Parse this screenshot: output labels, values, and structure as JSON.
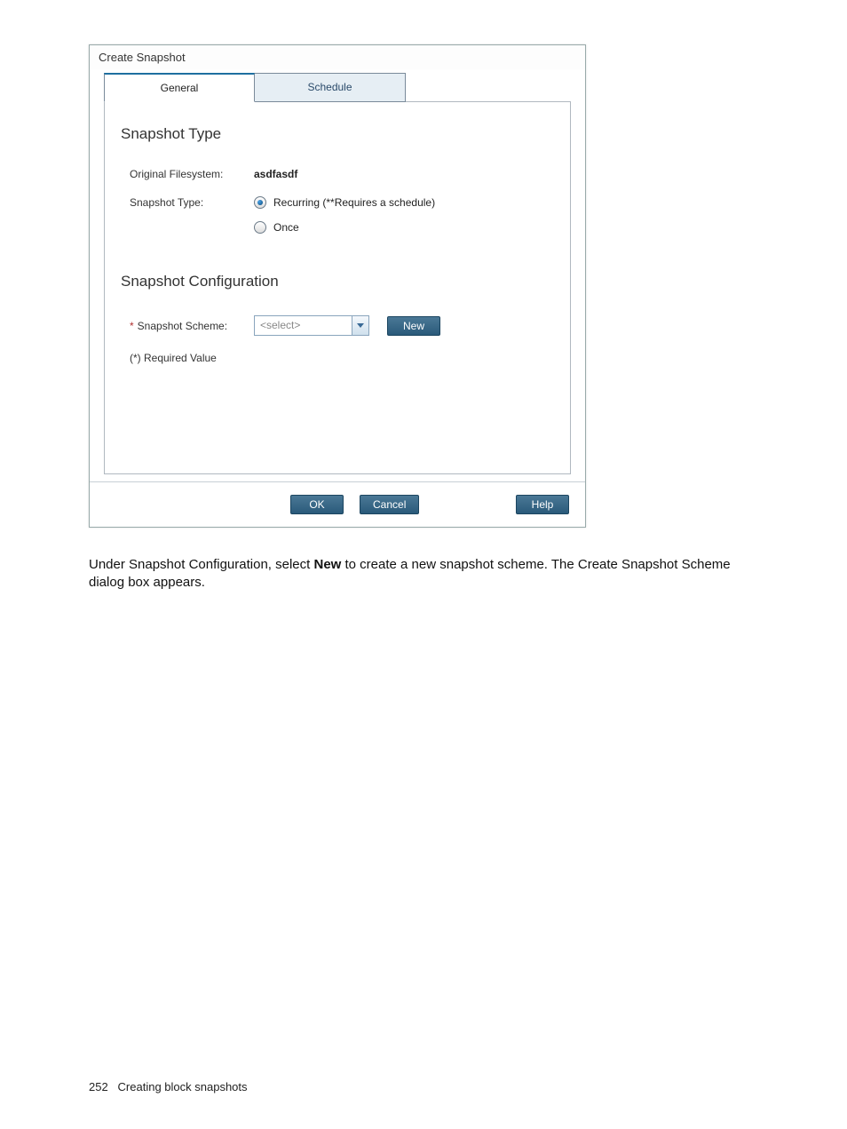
{
  "dialog": {
    "title": "Create Snapshot",
    "tabs": {
      "general": "General",
      "schedule": "Schedule"
    },
    "section_type": {
      "heading": "Snapshot Type",
      "orig_fs_label": "Original Filesystem:",
      "orig_fs_value": "asdfasdf",
      "snap_type_label": "Snapshot Type:",
      "opt_recurring": "Recurring (**Requires a schedule)",
      "opt_once": "Once"
    },
    "section_config": {
      "heading": "Snapshot Configuration",
      "scheme_label": "Snapshot Scheme:",
      "select_placeholder": "<select>",
      "new_btn": "New",
      "required_note": "(*) Required Value"
    },
    "buttons": {
      "ok": "OK",
      "cancel": "Cancel",
      "help": "Help"
    }
  },
  "doc": {
    "para_pre": "Under Snapshot Configuration, select ",
    "para_bold": "New",
    "para_post": " to create a new snapshot scheme. The Create Snapshot Scheme dialog box appears."
  },
  "footer": {
    "page_num": "252",
    "chapter": "Creating block snapshots"
  }
}
